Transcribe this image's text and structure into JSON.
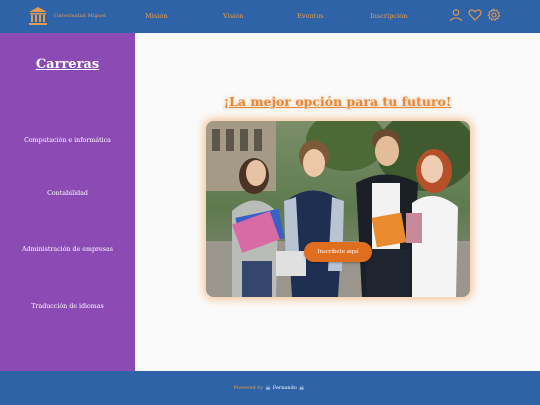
{
  "header": {
    "brand_name": "Universidad Miguel",
    "nav": [
      "Misión",
      "Visión",
      "Eventos",
      "Inscripción"
    ]
  },
  "sidebar": {
    "title": "Carreras",
    "items": [
      {
        "label": "Computación e informática"
      },
      {
        "label": "Contabilidad"
      },
      {
        "label": "Administración de empresas"
      },
      {
        "label": "Traducción de idiomas"
      }
    ]
  },
  "main": {
    "headline": "¡La mejor opción para tu futuro!",
    "cta_label": "Inscríbete aquí"
  },
  "footer": {
    "powered": "Powered by",
    "author": "Fernando"
  },
  "colors": {
    "header": "#2f63a8",
    "sidebar": "#8c4ab4",
    "accent": "#e59b4d",
    "cta": "#df6f1f"
  },
  "icons": [
    "university-icon",
    "user-icon",
    "heart-icon",
    "gear-icon",
    "skull-icon"
  ]
}
